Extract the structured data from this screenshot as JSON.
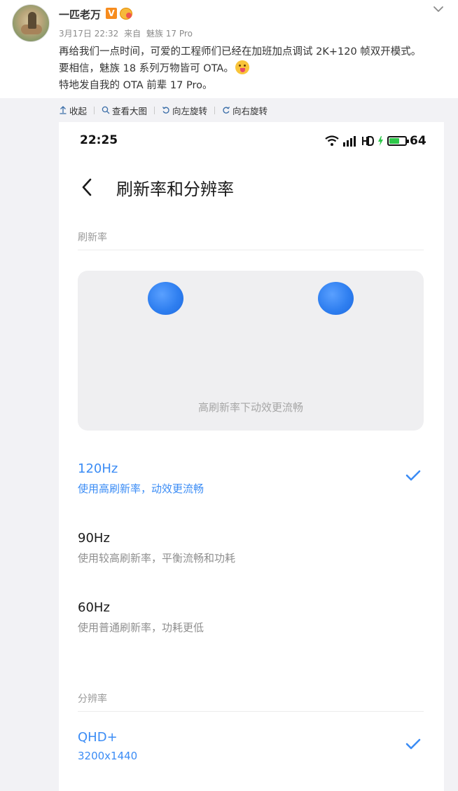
{
  "post": {
    "username": "一匹老万",
    "verified_badge": "V",
    "date": "3月17日 22:32",
    "source_prefix": "来自",
    "source_device": "魅族 17 Pro",
    "text_lines": [
      "再给我们一点时间，可爱的工程师们已经在加班加点调试 2K+120 帧双开模式。",
      "要相信，魅族 18 系列万物皆可 OTA。",
      "特地发自我的 OTA 前辈 17 Pro。"
    ]
  },
  "toolbar": {
    "collapse": "收起",
    "view_large": "查看大图",
    "rotate_left": "向左旋转",
    "rotate_right": "向右旋转"
  },
  "phone": {
    "status_time": "22:25",
    "battery_level": "64",
    "battery_fraction": 0.64,
    "page_title": "刷新率和分辨率",
    "refresh_section_label": "刷新率",
    "preview_caption": "高刷新率下动效更流畅",
    "refresh_options": [
      {
        "title": "120Hz",
        "subtitle": "使用高刷新率，动效更流畅",
        "selected": true
      },
      {
        "title": "90Hz",
        "subtitle": "使用较高刷新率，平衡流畅和功耗",
        "selected": false
      },
      {
        "title": "60Hz",
        "subtitle": "使用普通刷新率，功耗更低",
        "selected": false
      }
    ],
    "resolution_section_label": "分辨率",
    "resolution_options": [
      {
        "title": "QHD+",
        "subtitle": "3200x1440",
        "selected": true
      }
    ]
  },
  "colors": {
    "accent_blue": "#3b8cf5",
    "verified_orange": "#f78c1e",
    "battery_green": "#2ec84a"
  },
  "icons": [
    "chevron-down-icon",
    "collapse-arrow-icon",
    "magnifier-icon",
    "rotate-left-icon",
    "rotate-right-icon",
    "wifi-icon",
    "signal-icon",
    "hd-icon",
    "charging-icon",
    "battery-icon",
    "back-arrow-icon",
    "checkmark-icon"
  ]
}
